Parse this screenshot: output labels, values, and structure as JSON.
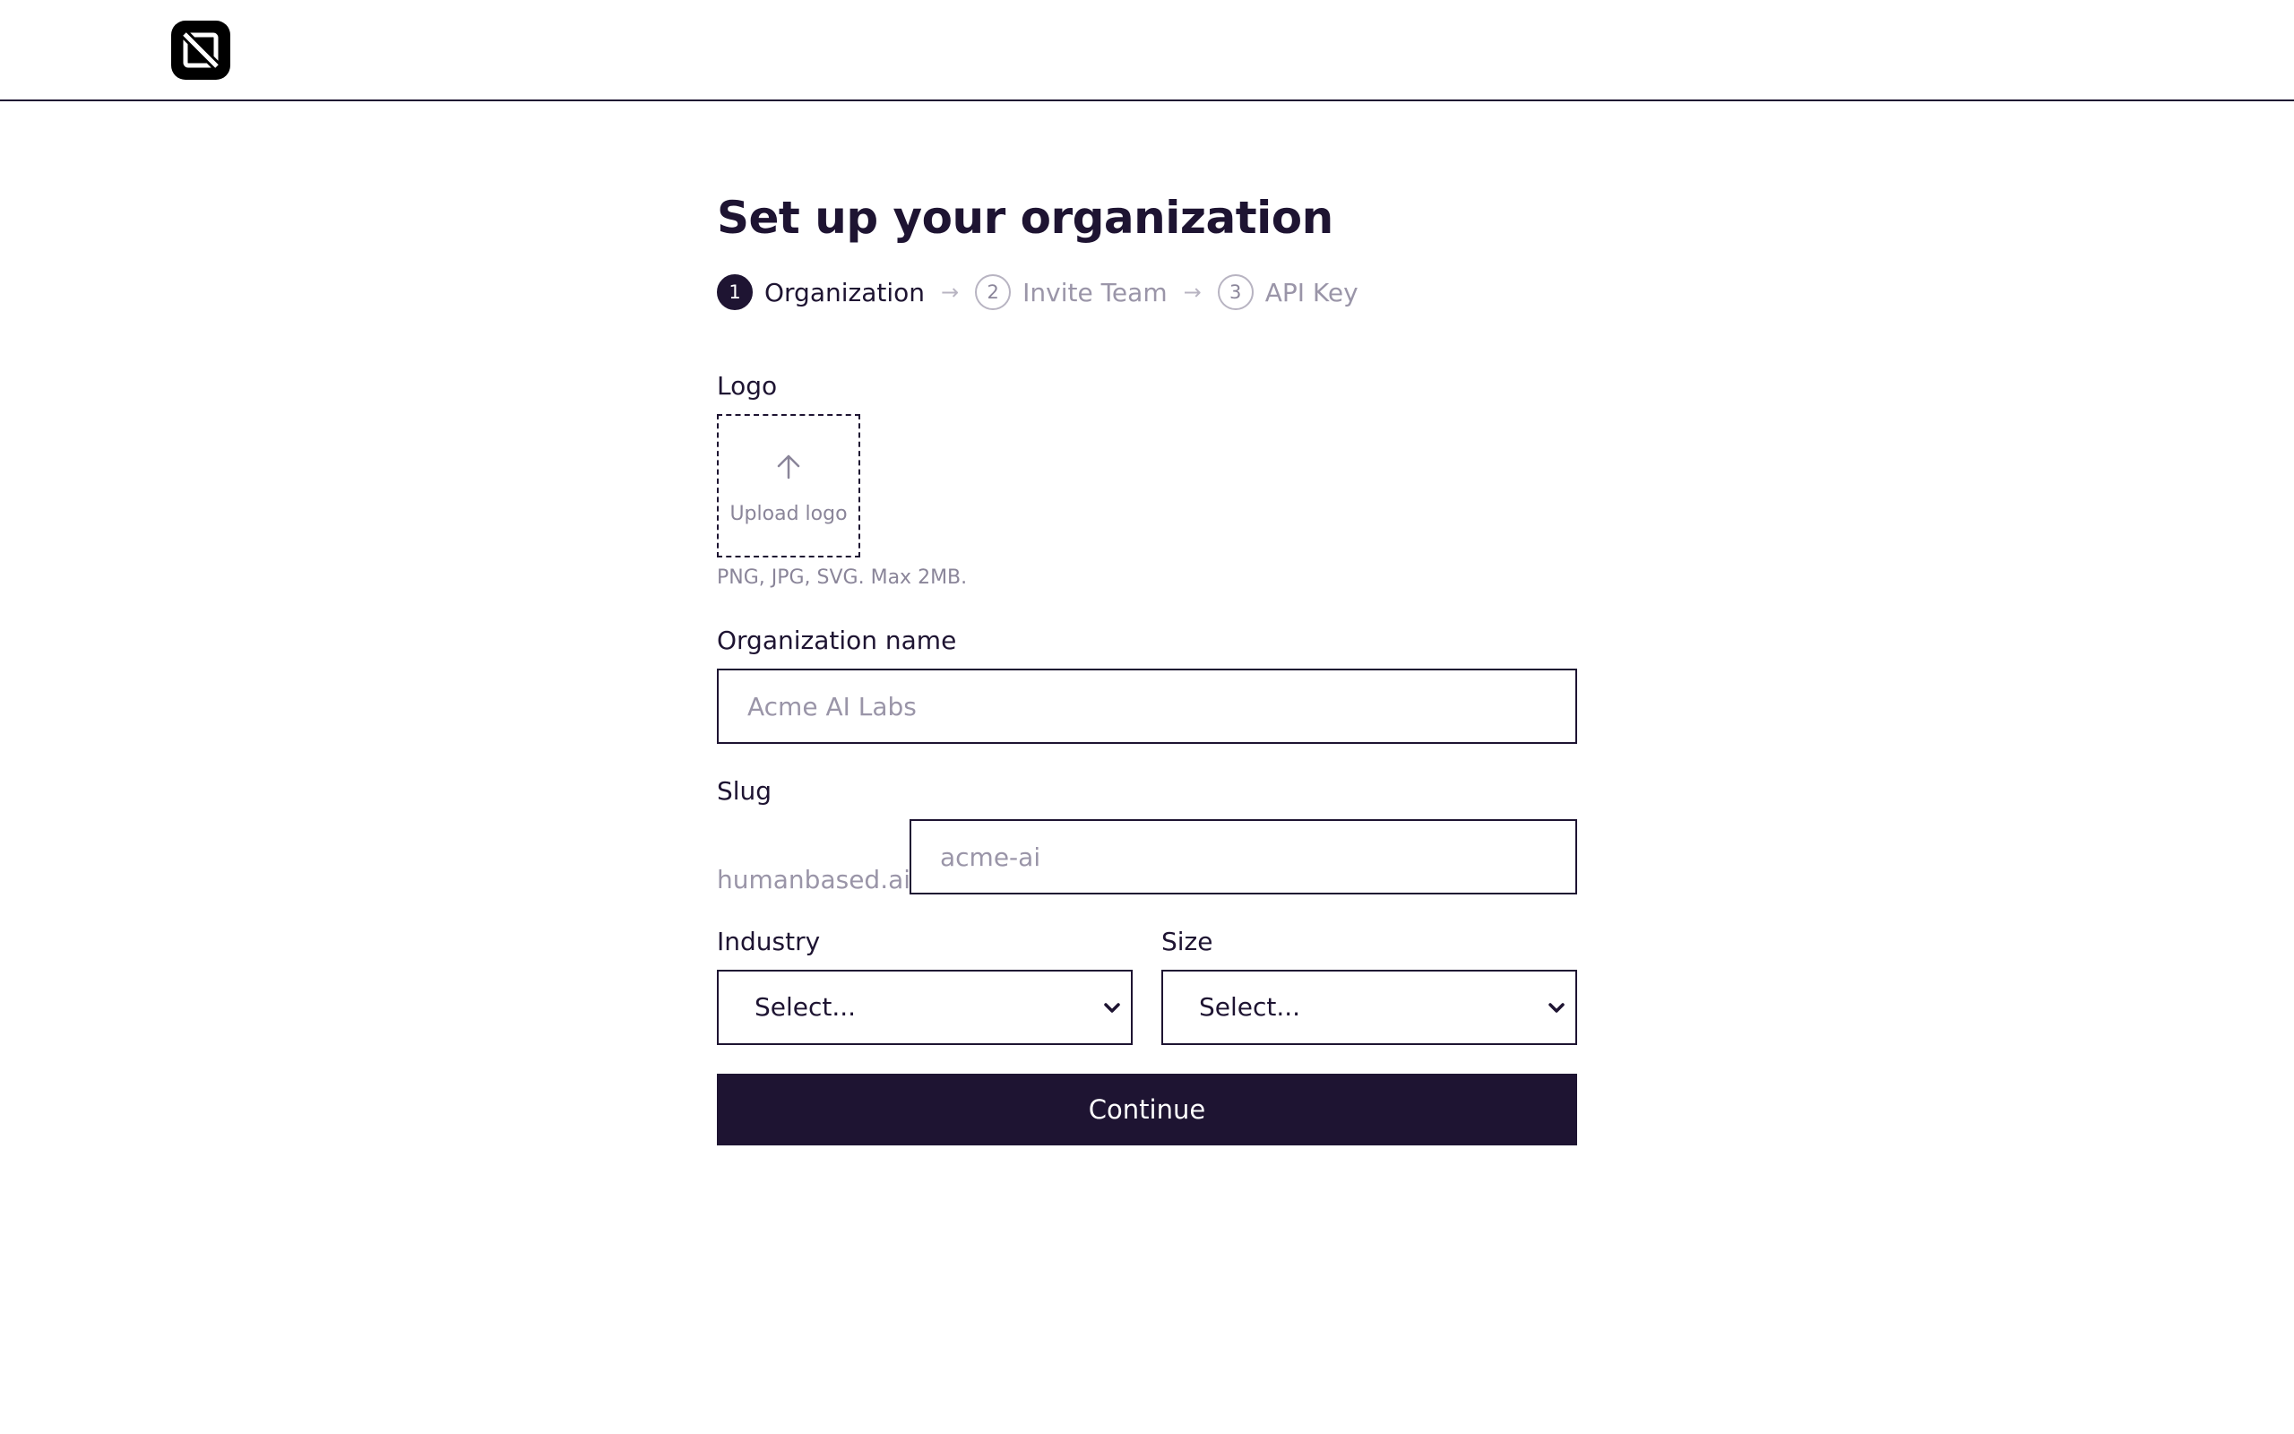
{
  "brand": {
    "logo_icon": "app-logo-icon"
  },
  "page": {
    "title": "Set up your organization"
  },
  "stepper": {
    "steps": [
      {
        "number": "1",
        "label": "Organization",
        "active": true
      },
      {
        "number": "2",
        "label": "Invite Team",
        "active": false
      },
      {
        "number": "3",
        "label": "API Key",
        "active": false
      }
    ],
    "separator": "→"
  },
  "logo_field": {
    "label": "Logo",
    "upload_label": "Upload logo",
    "upload_icon": "arrow-up-icon",
    "hint": "PNG, JPG, SVG. Max 2MB."
  },
  "org_name": {
    "label": "Organization name",
    "value": "",
    "placeholder": "Acme AI Labs"
  },
  "slug": {
    "label": "Slug",
    "prefix": "humanbased.ai/",
    "value": "",
    "placeholder": "acme-ai"
  },
  "industry": {
    "label": "Industry",
    "selected": "Select..."
  },
  "size": {
    "label": "Size",
    "selected": "Select..."
  },
  "actions": {
    "continue_label": "Continue"
  },
  "colors": {
    "primary": "#1e1432",
    "muted": "#9a95a8",
    "background": "#ffffff"
  }
}
